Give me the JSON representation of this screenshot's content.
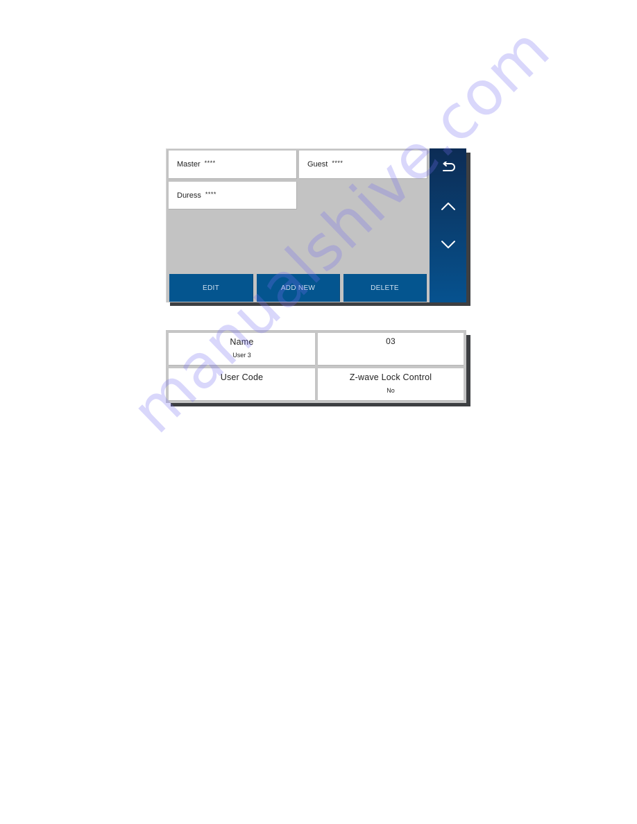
{
  "user_list_screen": {
    "users": [
      {
        "name": "Master",
        "code": "****"
      },
      {
        "name": "Guest",
        "code": "****"
      },
      {
        "name": "Duress",
        "code": "****"
      }
    ],
    "actions": {
      "edit_label": "EDIT",
      "add_new_label": "ADD NEW",
      "delete_label": "DELETE"
    },
    "nav": {
      "back_icon": "back-arrow-icon",
      "up_icon": "chevron-up-icon",
      "down_icon": "chevron-down-icon"
    }
  },
  "user_detail_screen": {
    "name_label": "Name",
    "name_value": "User 3",
    "user_number": "03",
    "user_code_label": "User Code",
    "user_code_value": "",
    "zwave_label": "Z-wave Lock Control",
    "zwave_value": "No"
  },
  "colors": {
    "button_blue": "#04558f",
    "nav_rail_top": "#0c2c55",
    "nav_rail_bottom": "#06528f",
    "list_background": "#c3c3c3",
    "shadow": "#3d3f42"
  },
  "watermark": "manualshive.com"
}
